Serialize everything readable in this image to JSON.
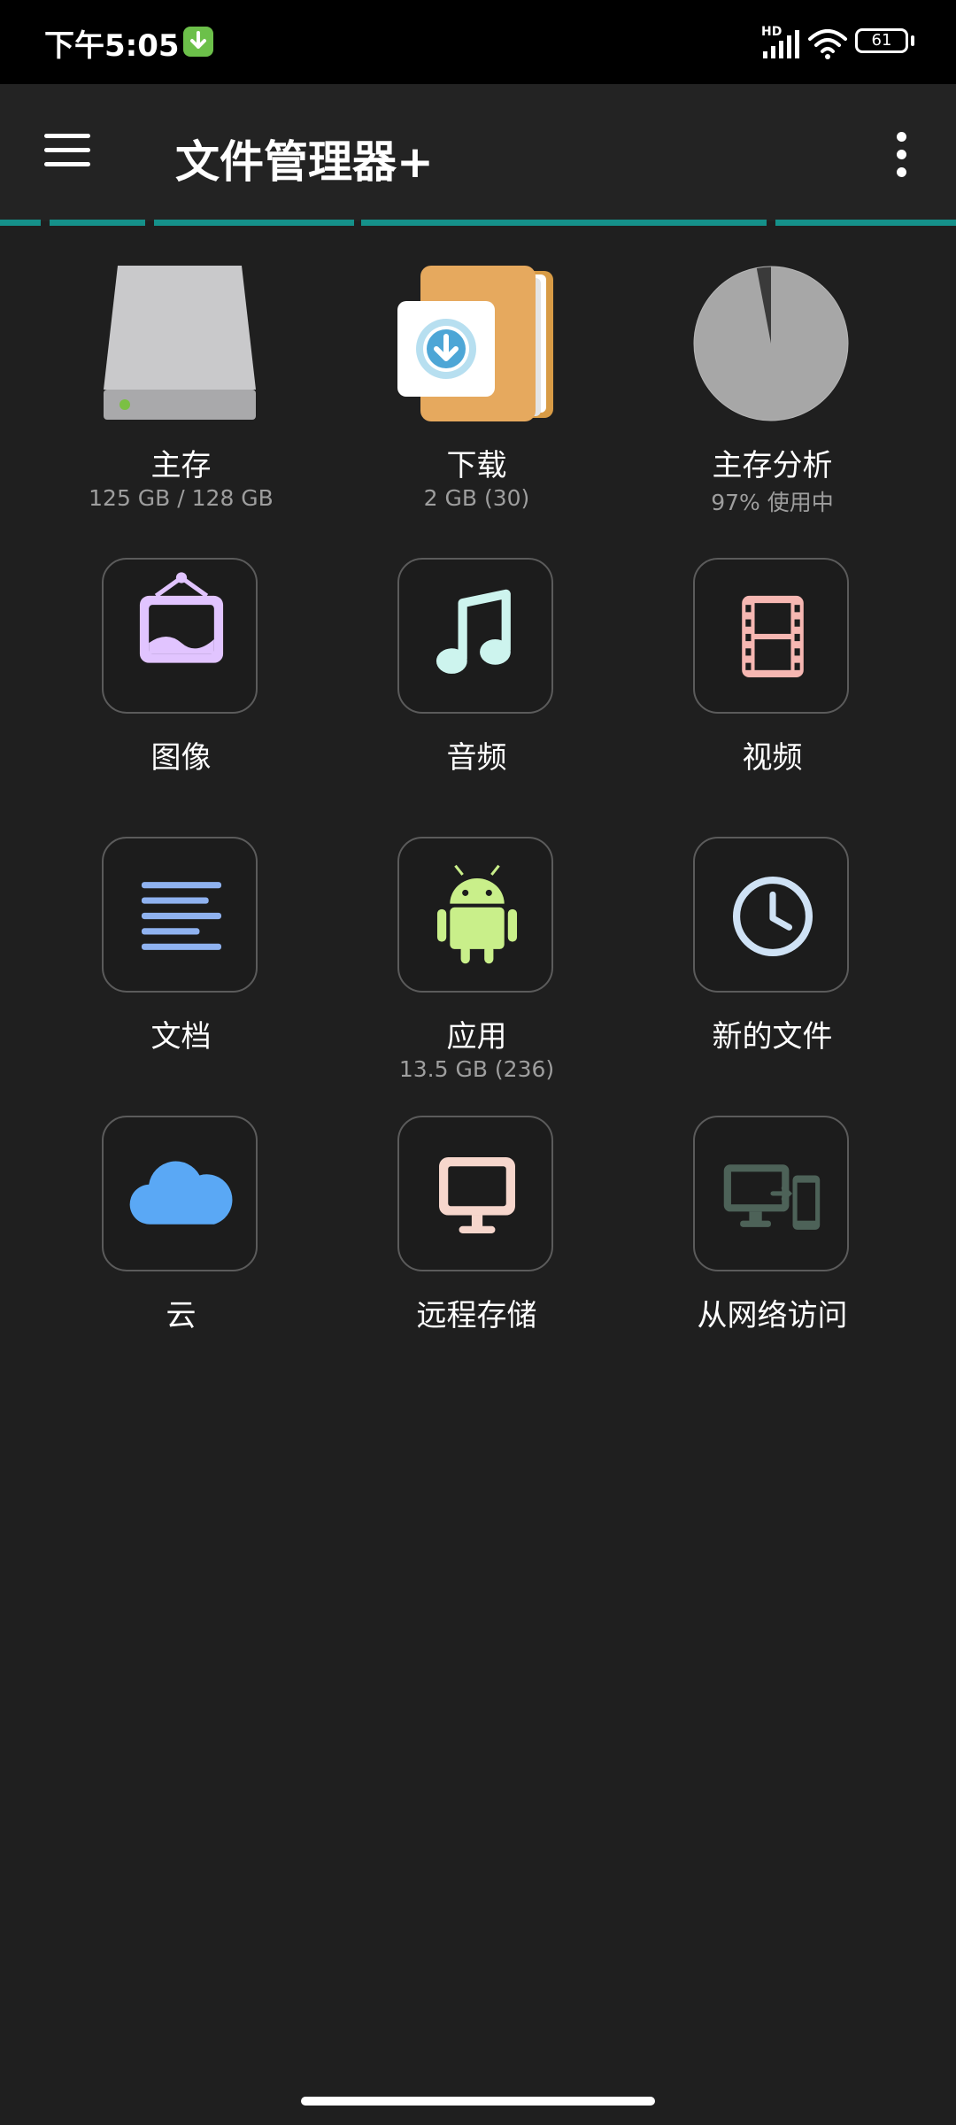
{
  "status_bar": {
    "time": "下午5:05",
    "network_label": "HD",
    "battery": "61"
  },
  "app_bar": {
    "title": "文件管理器+"
  },
  "colors": {
    "accent": "#15918a",
    "background": "#1f1f1f",
    "app_bar": "#232323"
  },
  "storage_usage_percent": 97,
  "items": [
    {
      "label": "主存",
      "sub": "125 GB / 128 GB",
      "icon": "hard-drive-icon"
    },
    {
      "label": "下载",
      "sub": "2 GB (30)",
      "icon": "download-folder-icon"
    },
    {
      "label": "主存分析",
      "sub": "97% 使用中",
      "icon": "pie-chart-icon"
    },
    {
      "label": "图像",
      "sub": "",
      "icon": "image-icon"
    },
    {
      "label": "音频",
      "sub": "",
      "icon": "music-note-icon"
    },
    {
      "label": "视频",
      "sub": "",
      "icon": "film-icon"
    },
    {
      "label": "文档",
      "sub": "",
      "icon": "document-lines-icon"
    },
    {
      "label": "应用",
      "sub": "13.5 GB (236)",
      "icon": "android-icon"
    },
    {
      "label": "新的文件",
      "sub": "",
      "icon": "clock-icon"
    },
    {
      "label": "云",
      "sub": "",
      "icon": "cloud-icon"
    },
    {
      "label": "远程存储",
      "sub": "",
      "icon": "monitor-icon"
    },
    {
      "label": "从网络访问",
      "sub": "",
      "icon": "devices-transfer-icon"
    }
  ]
}
